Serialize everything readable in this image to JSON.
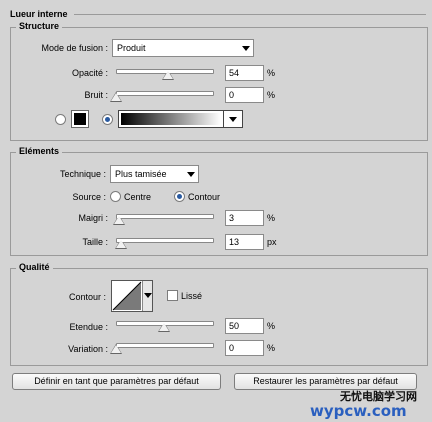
{
  "panel_title": "Lueur interne",
  "structure": {
    "legend": "Structure",
    "blend_mode_label": "Mode de fusion :",
    "blend_mode_value": "Produit",
    "opacity_label": "Opacité :",
    "opacity_value": "54",
    "opacity_fraction": 0.54,
    "opacity_unit": "%",
    "noise_label": "Bruit :",
    "noise_value": "0",
    "noise_fraction": 0,
    "noise_unit": "%",
    "color_swatch": "#000000"
  },
  "elements": {
    "legend": "Eléments",
    "technique_label": "Technique :",
    "technique_value": "Plus tamisée",
    "source_label": "Source :",
    "source_center_label": "Centre",
    "source_contour_label": "Contour",
    "source_selected": "Contour",
    "choke_label": "Maigri :",
    "choke_value": "3",
    "choke_fraction": 0.03,
    "choke_unit": "%",
    "size_label": "Taille :",
    "size_value": "13",
    "size_fraction": 0.052,
    "size_unit": "px"
  },
  "quality": {
    "legend": "Qualité",
    "contour_label": "Contour :",
    "antialias_label": "Lissé",
    "antialias_checked": false,
    "range_label": "Etendue :",
    "range_value": "50",
    "range_fraction": 0.5,
    "range_unit": "%",
    "jitter_label": "Variation :",
    "jitter_value": "0",
    "jitter_fraction": 0,
    "jitter_unit": "%"
  },
  "buttons": {
    "set_default": "Définir en tant que paramètres par défaut",
    "reset_default": "Restaurer les paramètres par défaut"
  },
  "watermark": {
    "line1": "无忧电脑学习网",
    "line2": "wypcw.com"
  }
}
